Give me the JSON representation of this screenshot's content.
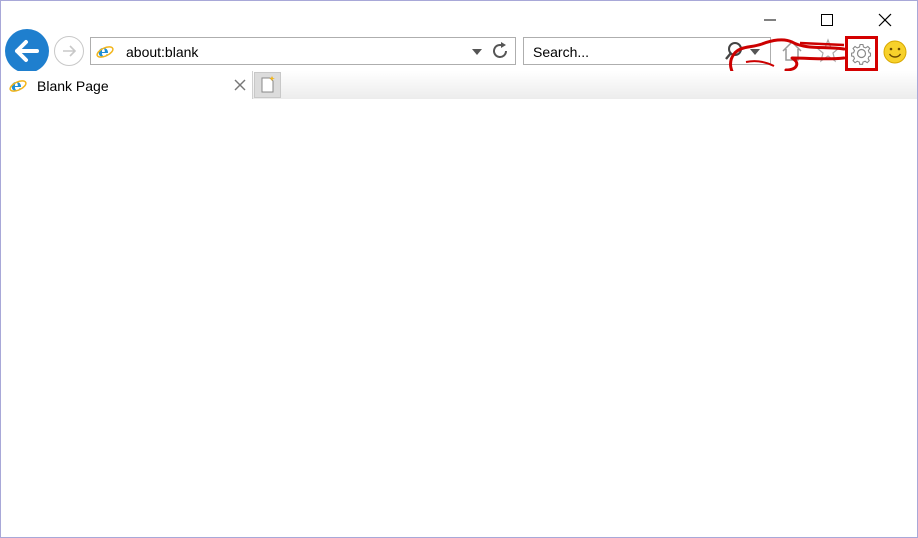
{
  "window": {
    "minimize_icon": "minimize-icon",
    "maximize_icon": "maximize-icon",
    "close_icon": "close-icon"
  },
  "nav": {
    "address": "about:blank",
    "search_placeholder": "Search..."
  },
  "tabs": [
    {
      "label": "Blank Page",
      "icon": "ie-icon"
    }
  ],
  "toolbar_icons": [
    "home-icon",
    "favorites-star-icon",
    "gear-icon",
    "smiley-feedback-icon"
  ],
  "colors": {
    "back_button": "#1f7fce",
    "highlight_red": "#d40000",
    "annotation_red": "#cc0000",
    "ie_blue": "#1e8fd6",
    "ie_ring": "#f2b51b"
  }
}
